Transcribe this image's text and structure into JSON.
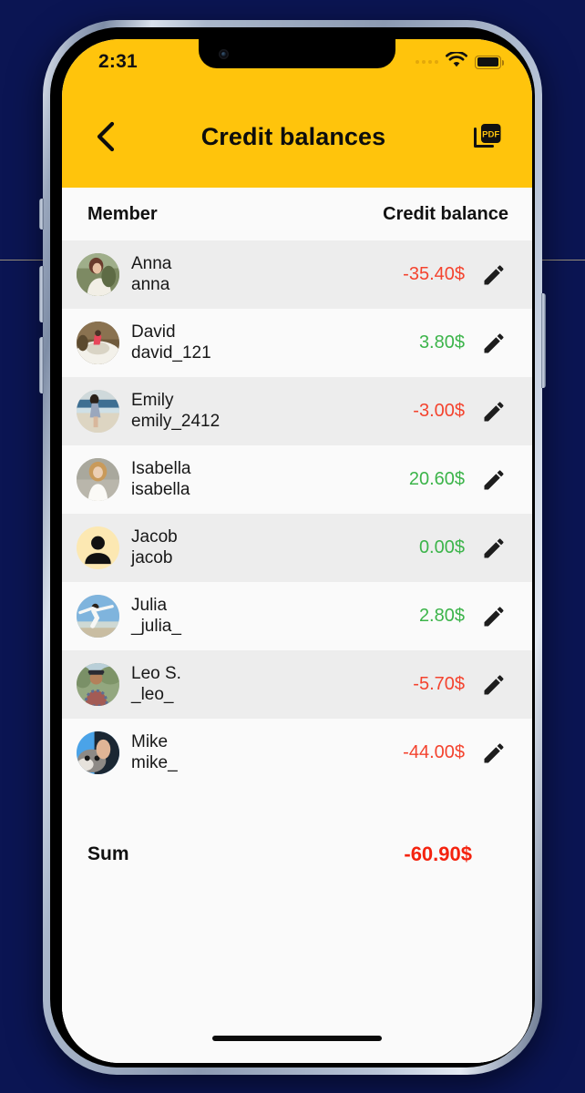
{
  "status_bar": {
    "time": "2:31",
    "cellular_icon": "cellular-dots-icon",
    "wifi_icon": "wifi-icon",
    "battery_icon": "battery-full-icon"
  },
  "nav": {
    "back_icon": "chevron-left-icon",
    "title": "Credit balances",
    "export_icon": "pdf-export-icon",
    "export_label": "PDF"
  },
  "table": {
    "columns": {
      "member": "Member",
      "balance": "Credit balance"
    },
    "edit_icon": "pencil-edit-icon",
    "rows": [
      {
        "name": "Anna",
        "handle": "anna",
        "amount": "-35.40$",
        "sign": "neg",
        "avatar": "photo-woman-field",
        "avatar_type": "photo"
      },
      {
        "name": "David",
        "handle": "david_121",
        "amount": "3.80$",
        "sign": "pos",
        "avatar": "photo-person-boat",
        "avatar_type": "photo"
      },
      {
        "name": "Emily",
        "handle": "emily_2412",
        "amount": "-3.00$",
        "sign": "neg",
        "avatar": "photo-woman-beach",
        "avatar_type": "photo"
      },
      {
        "name": "Isabella",
        "handle": "isabella",
        "amount": "20.60$",
        "sign": "pos",
        "avatar": "photo-woman-white-dress",
        "avatar_type": "photo"
      },
      {
        "name": "Jacob",
        "handle": "jacob",
        "amount": "0.00$",
        "sign": "pos",
        "avatar": "default-person-icon",
        "avatar_type": "placeholder"
      },
      {
        "name": "Julia",
        "handle": "_julia_",
        "amount": "2.80$",
        "sign": "pos",
        "avatar": "photo-woman-jumping-beach",
        "avatar_type": "photo"
      },
      {
        "name": "Leo S.",
        "handle": "_leo_",
        "amount": "-5.70$",
        "sign": "neg",
        "avatar": "photo-man-hat-shirt",
        "avatar_type": "photo"
      },
      {
        "name": "Mike",
        "handle": "mike_",
        "amount": "-44.00$",
        "sign": "neg",
        "avatar": "photo-man-dog",
        "avatar_type": "photo"
      }
    ],
    "sum": {
      "label": "Sum",
      "value": "-60.90$"
    }
  },
  "colors": {
    "header_yellow": "#ffc40c",
    "negative_red": "#f4432e",
    "positive_green": "#3cb44a",
    "sum_red": "#f4230f",
    "row_odd": "#ededed",
    "row_even": "#fafafa",
    "backdrop": "#0b1553",
    "placeholder_avatar_bg": "#fce8b2"
  }
}
